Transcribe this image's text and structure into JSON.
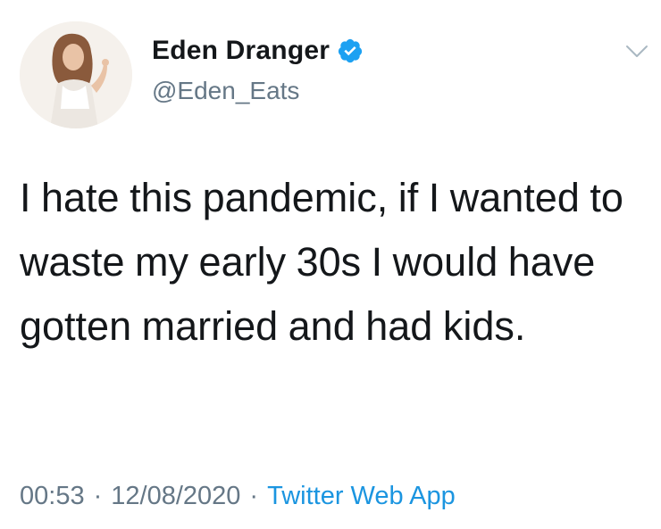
{
  "tweet": {
    "author": {
      "display_name": "Eden Dranger",
      "handle": "@Eden_Eats",
      "verified": true,
      "avatar": "profile-photo"
    },
    "text": "I hate this pandemic, if I wanted to waste my early 30s I would have gotten married and had kids.",
    "time": "00:53",
    "date": "12/08/2020",
    "separator": "·",
    "source": "Twitter Web App"
  },
  "icons": {
    "verified": "verified-badge-icon",
    "menu": "chevron-down-icon"
  },
  "colors": {
    "verified_blue": "#1da1f2",
    "link_blue": "#1b95e0",
    "text_primary": "#14171a",
    "text_secondary": "#657786",
    "chevron_gray": "#aab8c2"
  }
}
